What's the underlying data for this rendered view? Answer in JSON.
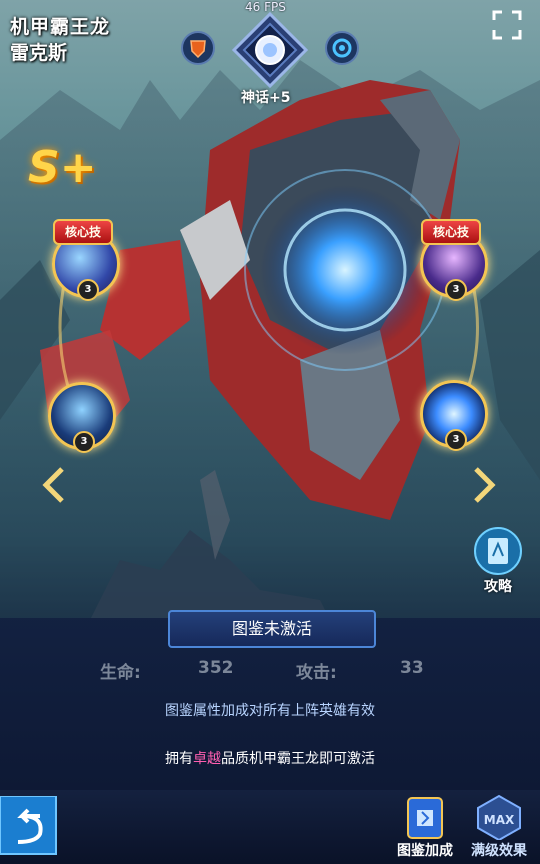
{
  "hero": {
    "name": "机甲霸王龙",
    "subtitle": "雷克斯"
  },
  "fps": "46 FPS",
  "rank": {
    "label": "神话+5",
    "grade": "S+"
  },
  "skills": [
    {
      "tag": "核心技",
      "level": "3"
    },
    {
      "level": "3"
    },
    {
      "tag": "核心技",
      "level": "3"
    },
    {
      "level": "3"
    }
  ],
  "guide": {
    "label": "攻略"
  },
  "codex": {
    "title": "图鉴未激活",
    "stats": [
      {
        "label": "生命:",
        "value": "352"
      },
      {
        "label": "攻击:",
        "value": "33"
      }
    ],
    "note": "图鉴属性加成对所有上阵英雄有效",
    "activate_prefix": "拥有",
    "activate_highlight": "卓越",
    "activate_suffix": "品质机甲霸王龙即可激活"
  },
  "footer": {
    "codex_bonus": "图鉴加成",
    "max_effect": "满级效果",
    "max_badge": "MAX"
  },
  "colors": {
    "gold": "#f3c553",
    "highlight": "#ff5fb0",
    "panel_border": "#4c86d8"
  }
}
